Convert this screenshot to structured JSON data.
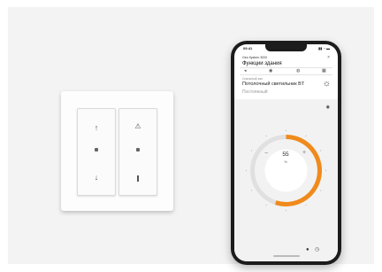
{
  "switch": {
    "left_rocker": {
      "top_symbol": "↑",
      "bottom_symbol": "↓"
    },
    "right_rocker": {
      "top_symbol": "⚠",
      "bottom_symbol": ""
    }
  },
  "phone": {
    "status_time": "09:41",
    "status_icons": "▮▮ ◔ ▬",
    "app_subtitle": "Gira System 3000",
    "close_icon": "×",
    "app_title": "Функции здания",
    "tabs": [
      "◂",
      "◉",
      "◍",
      "▦"
    ],
    "room_label": "Спальный зал",
    "device_name": "Потолочный светильник BT",
    "device_mode": "Постоянный",
    "sun_icon": "☼",
    "card_icon": "◉",
    "dial_value": "55",
    "dial_unit": "%",
    "dial_label": "Яркость",
    "dial_level": 0.55,
    "minus": "−",
    "plus": "+",
    "bottom_icon": "●",
    "bottom_icon2": "◷"
  },
  "colors": {
    "accent": "#f08a1c",
    "phone_body": "#1c1c1c",
    "background": "#f3f3f3"
  }
}
